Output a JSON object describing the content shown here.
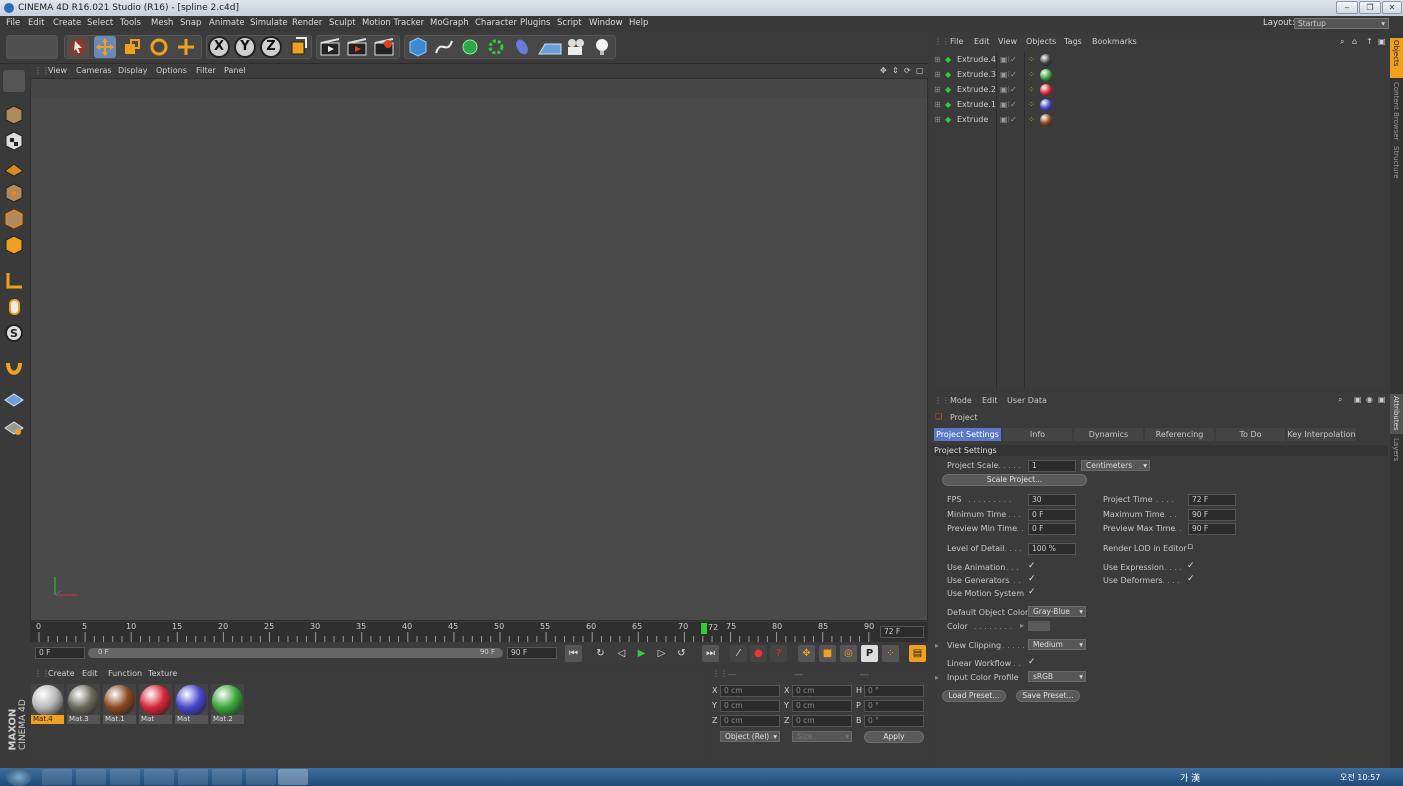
{
  "window": {
    "title": "CINEMA 4D R16.021 Studio (R16) - [spline 2.c4d]"
  },
  "menubar": {
    "items": [
      "File",
      "Edit",
      "Create",
      "Select",
      "Tools",
      "Mesh",
      "Snap",
      "Animate",
      "Simulate",
      "Render",
      "Sculpt",
      "Motion Tracker",
      "MoGraph",
      "Character",
      "Plugins",
      "Script",
      "Window",
      "Help"
    ],
    "layout_label": "Layout:",
    "layout_value": "Startup"
  },
  "viewport": {
    "menu": [
      "View",
      "Cameras",
      "Display",
      "Options",
      "Filter",
      "Panel"
    ]
  },
  "timeline": {
    "ticks": [
      "0",
      "5",
      "10",
      "15",
      "20",
      "25",
      "30",
      "35",
      "40",
      "45",
      "50",
      "55",
      "60",
      "65",
      "70",
      "75",
      "80",
      "85",
      "90"
    ],
    "current_marker": "72",
    "end_field": "72 F",
    "start_field": "0 F",
    "range_left": "0 F",
    "range_right": "90 F",
    "max_field": "90 F"
  },
  "material_manager": {
    "menu": [
      "Create",
      "Edit",
      "Function",
      "Texture"
    ],
    "materials": [
      {
        "name": "Mat.4",
        "color": "#b8b8b8"
      },
      {
        "name": "Mat.3",
        "color": "#6a6a5a"
      },
      {
        "name": "Mat.1",
        "color": "#8a4a22"
      },
      {
        "name": "Mat",
        "color": "#d8283a"
      },
      {
        "name": "Mat",
        "color": "#4848d0"
      },
      {
        "name": "Mat.2",
        "color": "#3ca83c"
      }
    ]
  },
  "coordinates": {
    "header": [
      "---",
      "---",
      "---"
    ],
    "rows": [
      {
        "a": "X",
        "av": "0 cm",
        "b": "X",
        "bv": "0 cm",
        "c": "H",
        "cv": "0 °"
      },
      {
        "a": "Y",
        "av": "0 cm",
        "b": "Y",
        "bv": "0 cm",
        "c": "P",
        "cv": "0 °"
      },
      {
        "a": "Z",
        "av": "0 cm",
        "b": "Z",
        "bv": "0 cm",
        "c": "B",
        "cv": "0 °"
      }
    ],
    "mode_select": "Object (Rel)",
    "size_select": "Size",
    "apply_label": "Apply"
  },
  "object_manager": {
    "menu": [
      "File",
      "Edit",
      "View",
      "Objects",
      "Tags",
      "Bookmarks"
    ],
    "objects": [
      {
        "name": "Extrude.4",
        "tag": "#404040"
      },
      {
        "name": "Extrude.3",
        "tag": "#3ca83c"
      },
      {
        "name": "Extrude.2",
        "tag": "#d8283a"
      },
      {
        "name": "Extrude.1",
        "tag": "#4848d0"
      },
      {
        "name": "Extrude",
        "tag": "#8a4a22"
      }
    ]
  },
  "attributes": {
    "menu": [
      "Mode",
      "Edit",
      "User Data"
    ],
    "object_label": "Project",
    "tabs": [
      "Project Settings",
      "Info",
      "Dynamics",
      "Referencing",
      "To Do",
      "Key Interpolation"
    ],
    "section": "Project Settings",
    "project_scale_label": "Project Scale",
    "project_scale_value": "1",
    "project_scale_unit": "Centimeters",
    "scale_project_button": "Scale Project...",
    "fps_label": "FPS",
    "fps_value": "30",
    "project_time_label": "Project Time",
    "project_time_value": "72 F",
    "min_time_label": "Minimum Time",
    "min_time_value": "0 F",
    "max_time_label": "Maximum Time",
    "max_time_value": "90 F",
    "prev_min_label": "Preview Min Time",
    "prev_min_value": "0 F",
    "prev_max_label": "Preview Max Time",
    "prev_max_value": "90 F",
    "lod_label": "Level of Detail",
    "lod_value": "100 %",
    "render_lod_label": "Render LOD in Editor",
    "use_animation": "Use Animation",
    "use_expression": "Use Expression",
    "use_generators": "Use Generators",
    "use_deformers": "Use Deformers",
    "use_motion": "Use Motion System",
    "default_color_label": "Default Object Color",
    "default_color_value": "Gray-Blue",
    "color_label": "Color",
    "view_clipping_label": "View Clipping",
    "view_clipping_value": "Medium",
    "linear_workflow_label": "Linear Workflow",
    "input_profile_label": "Input Color Profile",
    "input_profile_value": "sRGB",
    "load_preset": "Load Preset...",
    "save_preset": "Save Preset..."
  },
  "side_tabs": [
    "Objects",
    "Content Browser",
    "Structure",
    "Attributes",
    "Layers"
  ],
  "taskbar": {
    "clock": "오전 10:57",
    "ime": "가 漢"
  },
  "brand": {
    "maxon": "MAXON",
    "product": "CINEMA 4D"
  }
}
